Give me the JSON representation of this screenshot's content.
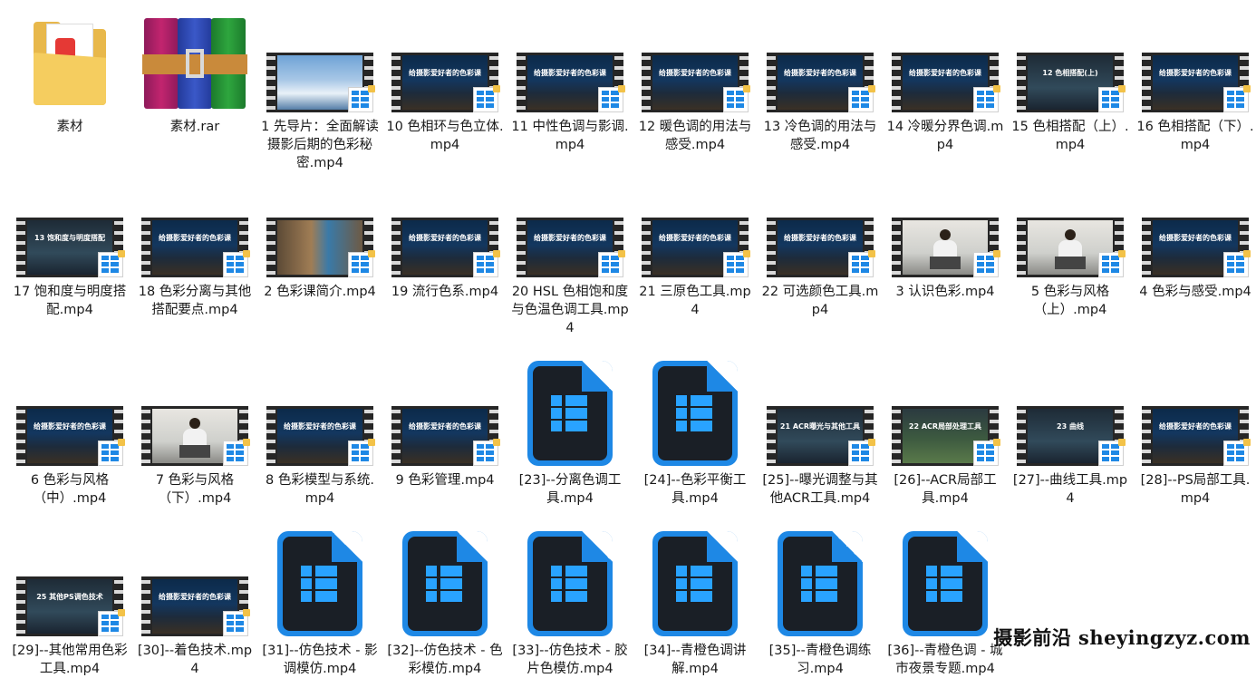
{
  "files": [
    {
      "label": "素材",
      "type": "folder"
    },
    {
      "label": "素材.rar",
      "type": "rar"
    },
    {
      "label": "1 先导片：全面解读摄影后期的色彩秘密.mp4",
      "type": "video",
      "thumb": "sky"
    },
    {
      "label": "10 色相环与色立体.mp4",
      "type": "video",
      "thumb": "title",
      "title": "给摄影爱好者的色彩课"
    },
    {
      "label": "11 中性色调与影调.mp4",
      "type": "video",
      "thumb": "title",
      "title": "给摄影爱好者的色彩课"
    },
    {
      "label": "12 暖色调的用法与感受.mp4",
      "type": "video",
      "thumb": "title",
      "title": "给摄影爱好者的色彩课"
    },
    {
      "label": "13 冷色调的用法与感受.mp4",
      "type": "video",
      "thumb": "title",
      "title": "给摄影爱好者的色彩课"
    },
    {
      "label": "14 冷暖分界色调.mp4",
      "type": "video",
      "thumb": "title",
      "title": "给摄影爱好者的色彩课"
    },
    {
      "label": "15 色相搭配（上）.mp4",
      "type": "video",
      "thumb": "chapter",
      "title": "12 色相搭配(上)"
    },
    {
      "label": "16 色相搭配（下）.mp4",
      "type": "video",
      "thumb": "title",
      "title": "给摄影爱好者的色彩课"
    },
    {
      "label": "17 饱和度与明度搭配.mp4",
      "type": "video",
      "thumb": "chapter",
      "title": "13 饱和度与明度搭配"
    },
    {
      "label": "18 色彩分离与其他搭配要点.mp4",
      "type": "video",
      "thumb": "title",
      "title": "给摄影爱好者的色彩课"
    },
    {
      "label": "2 色彩课简介.mp4",
      "type": "video",
      "thumb": "window"
    },
    {
      "label": "19 流行色系.mp4",
      "type": "video",
      "thumb": "title",
      "title": "给摄影爱好者的色彩课"
    },
    {
      "label": "20 HSL 色相饱和度与色温色调工具.mp4",
      "type": "video",
      "thumb": "title",
      "title": "给摄影爱好者的色彩课"
    },
    {
      "label": "21 三原色工具.mp4",
      "type": "video",
      "thumb": "title",
      "title": "给摄影爱好者的色彩课"
    },
    {
      "label": "22 可选颜色工具.mp4",
      "type": "video",
      "thumb": "title",
      "title": "给摄影爱好者的色彩课"
    },
    {
      "label": "3 认识色彩.mp4",
      "type": "video",
      "thumb": "person"
    },
    {
      "label": "5 色彩与风格（上）.mp4",
      "type": "video",
      "thumb": "person"
    },
    {
      "label": "4 色彩与感受.mp4",
      "type": "video",
      "thumb": "title",
      "title": "给摄影爱好者的色彩课"
    },
    {
      "label": "6 色彩与风格（中）.mp4",
      "type": "video",
      "thumb": "title",
      "title": "给摄影爱好者的色彩课"
    },
    {
      "label": "7 色彩与风格（下）.mp4",
      "type": "video",
      "thumb": "person"
    },
    {
      "label": "8 色彩模型与系统.mp4",
      "type": "video",
      "thumb": "title",
      "title": "给摄影爱好者的色彩课"
    },
    {
      "label": "9 色彩管理.mp4",
      "type": "video",
      "thumb": "title",
      "title": "给摄影爱好者的色彩课"
    },
    {
      "label": "[23]--分离色调工具.mp4",
      "type": "vfile"
    },
    {
      "label": "[24]--色彩平衡工具.mp4",
      "type": "vfile"
    },
    {
      "label": "[25]--曝光调整与其他ACR工具.mp4",
      "type": "video",
      "thumb": "chapter",
      "title": "21 ACR曝光与其他工具"
    },
    {
      "label": "[26]--ACR局部工具.mp4",
      "type": "video",
      "thumb": "green",
      "title": "22 ACR局部处理工具"
    },
    {
      "label": "[27]--曲线工具.mp4",
      "type": "video",
      "thumb": "chapter",
      "title": "23 曲线"
    },
    {
      "label": "[28]--PS局部工具.mp4",
      "type": "video",
      "thumb": "title",
      "title": "给摄影爱好者的色彩课"
    },
    {
      "label": "[29]--其他常用色彩工具.mp4",
      "type": "video",
      "thumb": "chapter",
      "title": "25 其他PS调色技术"
    },
    {
      "label": "[30]--着色技术.mp4",
      "type": "video",
      "thumb": "title",
      "title": "给摄影爱好者的色彩课"
    },
    {
      "label": "[31]--仿色技术 - 影调模仿.mp4",
      "type": "vfile"
    },
    {
      "label": "[32]--仿色技术 - 色彩模仿.mp4",
      "type": "vfile"
    },
    {
      "label": "[33]--仿色技术 - 胶片色模仿.mp4",
      "type": "vfile"
    },
    {
      "label": "[34]--青橙色调讲解.mp4",
      "type": "vfile"
    },
    {
      "label": "[35]--青橙色调练习.mp4",
      "type": "vfile"
    },
    {
      "label": "[36]--青橙色调 - 城市夜景专题.mp4",
      "type": "vfile"
    }
  ],
  "watermark": "摄影前沿 sheyingzyz.com"
}
